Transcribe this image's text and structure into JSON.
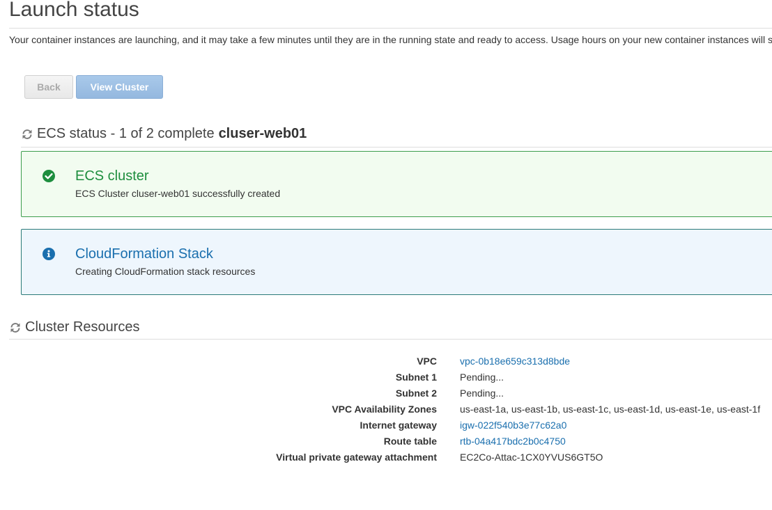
{
  "header": {
    "title": "Launch status",
    "intro": "Your container instances are launching, and it may take a few minutes until they are in the running state and ready to access. Usage hours on your new container instances will start immediately and continue to accrue until you stop or terminate your instances."
  },
  "buttons": {
    "back": "Back",
    "view_cluster": "View Cluster"
  },
  "ecs_status": {
    "heading": "ECS status - 1 of 2 complete",
    "cluster_name": "cluser-web01",
    "steps": [
      {
        "title": "ECS cluster",
        "message": "ECS Cluster cluser-web01 successfully created",
        "status": "success",
        "icon": "check-circle-icon"
      },
      {
        "title": "CloudFormation Stack",
        "message": "Creating CloudFormation stack resources",
        "status": "info",
        "icon": "info-circle-icon"
      }
    ]
  },
  "cluster_resources": {
    "heading": "Cluster Resources",
    "rows": [
      {
        "label": "VPC",
        "value": "vpc-0b18e659c313d8bde",
        "link": true
      },
      {
        "label": "Subnet 1",
        "value": "Pending...",
        "link": false
      },
      {
        "label": "Subnet 2",
        "value": "Pending...",
        "link": false
      },
      {
        "label": "VPC Availability Zones",
        "value": "us-east-1a, us-east-1b, us-east-1c, us-east-1d, us-east-1e, us-east-1f",
        "link": false
      },
      {
        "label": "Internet gateway",
        "value": "igw-022f540b3e77c62a0",
        "link": true
      },
      {
        "label": "Route table",
        "value": "rtb-04a417bdc2b0c4750",
        "link": true
      },
      {
        "label": "Virtual private gateway attachment",
        "value": "EC2Co-Attac-1CX0YVUS6GT5O",
        "link": false
      }
    ]
  },
  "colors": {
    "success": "#1e8e3e",
    "info": "#1a6fae",
    "link": "#1a6fae"
  }
}
